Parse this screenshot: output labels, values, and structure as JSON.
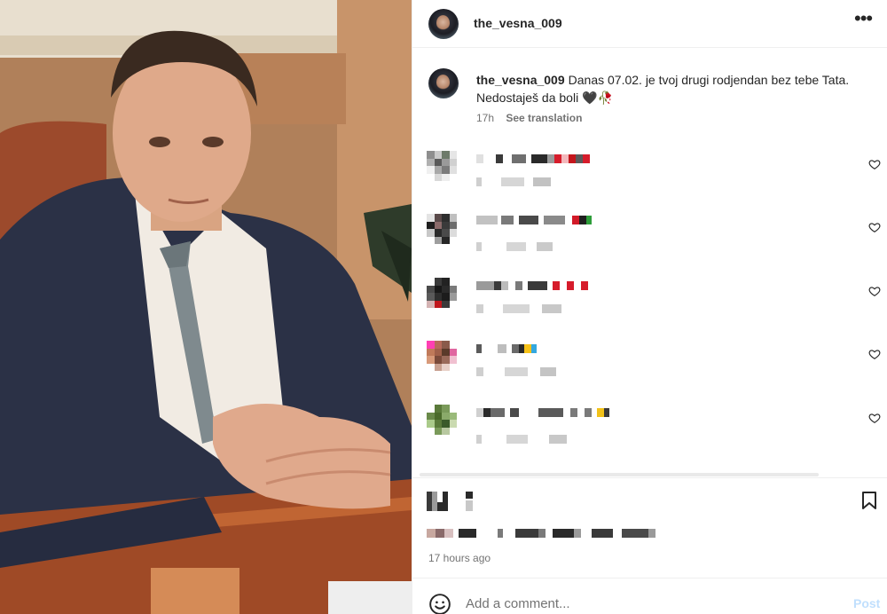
{
  "post": {
    "username": "the_vesna_009",
    "caption": "Danas 07.02. je tvoj drugi rodjendan bez tebe Tata. Nedostaješ da boli 🖤🥀",
    "caption_age": "17h",
    "see_translation": "See translation",
    "timestamp": "17 hours ago"
  },
  "icons": {
    "more": "more-options-icon",
    "heart": "heart-outline-icon",
    "bookmark": "bookmark-icon",
    "emoji": "emoji-smiley-icon"
  },
  "comment_box": {
    "placeholder": "Add a comment...",
    "post_label": "Post"
  },
  "colors": {
    "text": "#262626",
    "secondary": "#737373",
    "post_disabled": "#c0dffd",
    "divider": "#efefef"
  }
}
